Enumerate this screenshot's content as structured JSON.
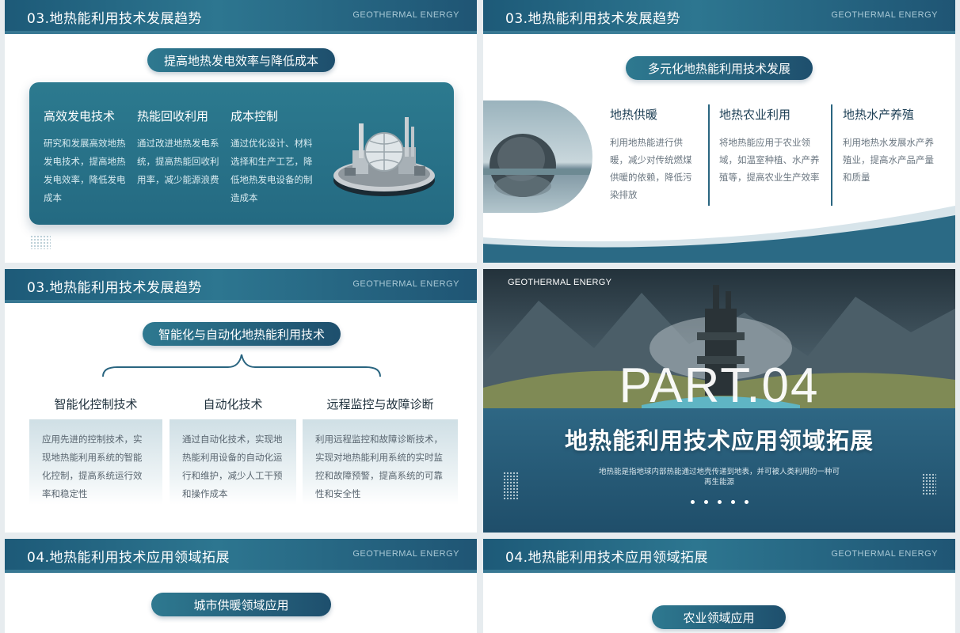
{
  "slides": [
    {
      "header": {
        "title": "03.地热能利用技术发展趋势",
        "brand": "GEOTHERMAL ENERGY"
      },
      "pill": "提高地热发电效率与降低成本",
      "columns": [
        {
          "title": "高效发电技术",
          "desc": "研究和发展高效地热发电技术，提高地热发电效率，降低发电成本"
        },
        {
          "title": "热能回收利用",
          "desc": "通过改进地热发电系统，提高热能回收利用率，减少能源浪费"
        },
        {
          "title": "成本控制",
          "desc": "通过优化设计、材料选择和生产工艺，降低地热发电设备的制造成本"
        }
      ]
    },
    {
      "header": {
        "title": "03.地热能利用技术发展趋势",
        "brand": "GEOTHERMAL ENERGY"
      },
      "pill": "多元化地热能利用技术发展",
      "columns": [
        {
          "title": "地热供暖",
          "desc": "利用地热能进行供暖，减少对传统燃煤供暖的依赖，降低污染排放"
        },
        {
          "title": "地热农业利用",
          "desc": "将地热能应用于农业领域，如温室种植、水产养殖等，提高农业生产效率"
        },
        {
          "title": "地热水产养殖",
          "desc": "利用地热水发展水产养殖业，提高水产品产量和质量"
        }
      ]
    },
    {
      "header": {
        "title": "03.地热能利用技术发展趋势",
        "brand": "GEOTHERMAL ENERGY"
      },
      "pill": "智能化与自动化地热能利用技术",
      "columns": [
        {
          "title": "智能化控制技术",
          "desc": "应用先进的控制技术，实现地热能利用系统的智能化控制，提高系统运行效率和稳定性"
        },
        {
          "title": "自动化技术",
          "desc": "通过自动化技术，实现地热能利用设备的自动化运行和维护，减少人工干预和操作成本"
        },
        {
          "title": "远程监控与故障诊断",
          "desc": "利用远程监控和故障诊断技术，实现对地热能利用系统的实时监控和故障预警，提高系统的可靠性和安全性"
        }
      ]
    },
    {
      "brand": "GEOTHERMAL ENERGY",
      "part": "PART.04",
      "title": "地热能利用技术应用领域拓展",
      "desc": "地热能是指地球内部热能通过地壳传递到地表，并可被人类利用的一种可再生能源"
    },
    {
      "header": {
        "title": "04.地热能利用技术应用领域拓展",
        "brand": "GEOTHERMAL ENERGY"
      },
      "pill": "城市供暖领域应用"
    },
    {
      "header": {
        "title": "04.地热能利用技术应用领域拓展",
        "brand": "GEOTHERMAL ENERGY"
      },
      "pill": "农业领域应用"
    }
  ],
  "colors": {
    "primary": "#245f7c",
    "accent": "#2e7990",
    "text_dark": "#1d3f55"
  },
  "icons": [
    "power-plant-icon",
    "lake-rock-image",
    "mountain-factory-image"
  ]
}
